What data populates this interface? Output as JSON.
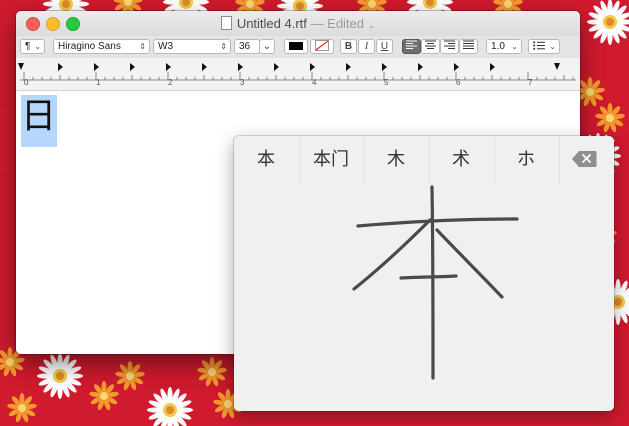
{
  "window": {
    "title": "Untitled 4.rtf",
    "status": "— Edited",
    "chevron": "⌄"
  },
  "toolbar": {
    "paragraph_style": "¶",
    "font_family": "Hiragino Sans",
    "font_weight": "W3",
    "font_size": "36",
    "bold": "B",
    "italic": "I",
    "underline": "U",
    "line_spacing": "1.0",
    "list_icon": "list-bullets-icon"
  },
  "ruler": {
    "numbers": [
      "0",
      "1",
      "2",
      "3",
      "4",
      "5",
      "6",
      "7"
    ]
  },
  "document": {
    "text": "日"
  },
  "handwriting": {
    "candidates": [
      "本",
      "本门",
      "木",
      "术",
      "ホ"
    ],
    "backspace_icon": "delete-left-icon"
  },
  "colors": {
    "desktop": "#d01a2e",
    "selection": "#b4d7fb",
    "close": "#fc5f57",
    "minimize": "#fdbc2e",
    "zoom": "#28c840"
  }
}
